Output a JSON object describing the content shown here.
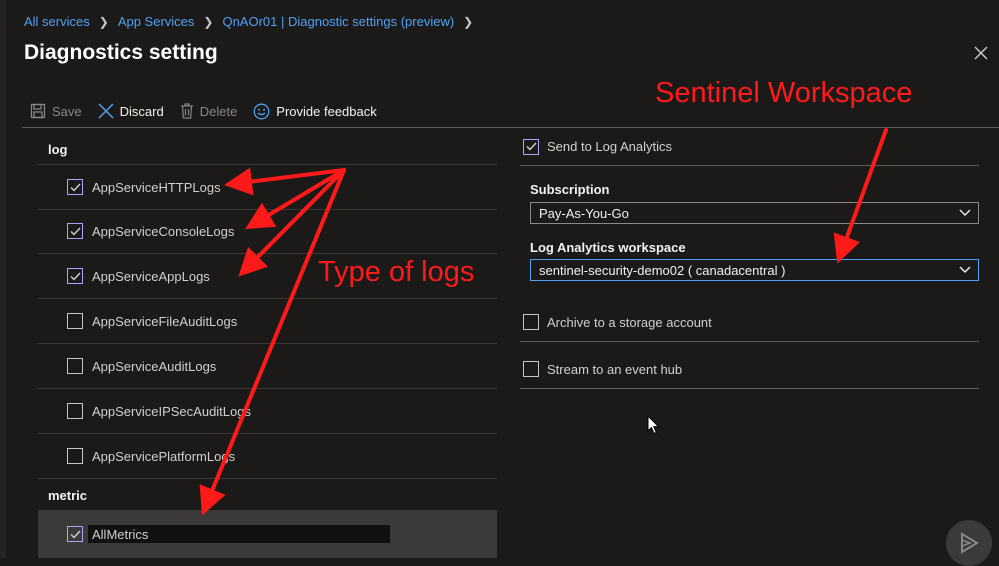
{
  "breadcrumb": [
    {
      "label": "All services"
    },
    {
      "label": "App Services"
    },
    {
      "label": "QnAOr01 | Diagnostic settings (preview)"
    }
  ],
  "page_title": "Diagnostics setting",
  "toolbar": {
    "save_label": "Save",
    "discard_label": "Discard",
    "delete_label": "Delete",
    "feedback_label": "Provide feedback"
  },
  "log_section": {
    "header": "log",
    "items": [
      {
        "label": "AppServiceHTTPLogs",
        "checked": true
      },
      {
        "label": "AppServiceConsoleLogs",
        "checked": true
      },
      {
        "label": "AppServiceAppLogs",
        "checked": true
      },
      {
        "label": "AppServiceFileAuditLogs",
        "checked": false
      },
      {
        "label": "AppServiceAuditLogs",
        "checked": false
      },
      {
        "label": "AppServiceIPSecAuditLogs",
        "checked": false
      },
      {
        "label": "AppServicePlatformLogs",
        "checked": false
      }
    ]
  },
  "metric_section": {
    "header": "metric",
    "items": [
      {
        "label": "AllMetrics",
        "checked": true
      }
    ]
  },
  "destinations": {
    "log_analytics": {
      "label": "Send to Log Analytics",
      "checked": true
    },
    "subscription": {
      "label": "Subscription",
      "value": "Pay-As-You-Go"
    },
    "workspace": {
      "label": "Log Analytics workspace",
      "value": "sentinel-security-demo02 ( canadacentral )"
    },
    "storage": {
      "label": "Archive to a storage account",
      "checked": false
    },
    "event_hub": {
      "label": "Stream to an event hub",
      "checked": false
    }
  },
  "annotations": {
    "sentinel": "Sentinel Workspace",
    "logs": "Type of logs",
    "color": "#ff1a1a"
  },
  "colors": {
    "background": "#1b1a19",
    "link": "#4ea1f2",
    "checkbox_accent": "#b4a0ff"
  }
}
